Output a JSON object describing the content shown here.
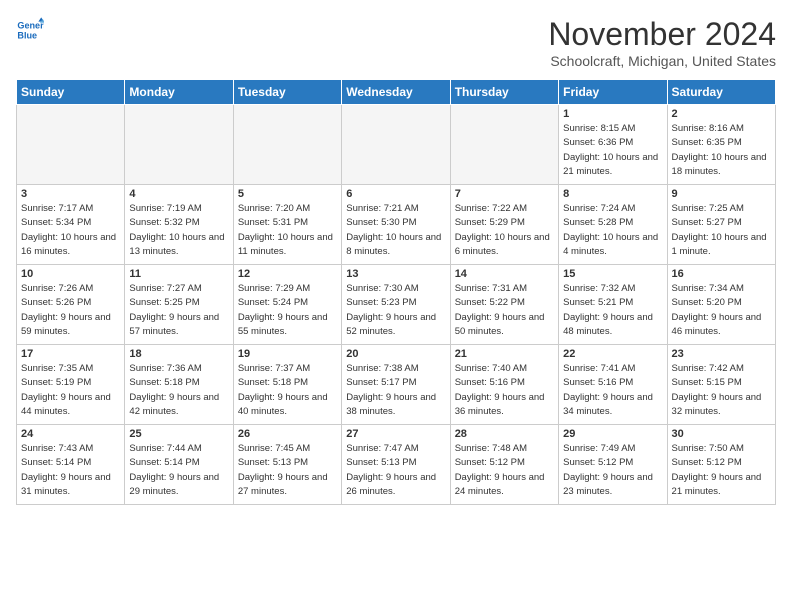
{
  "header": {
    "logo_line1": "General",
    "logo_line2": "Blue",
    "month": "November 2024",
    "location": "Schoolcraft, Michigan, United States"
  },
  "days_of_week": [
    "Sunday",
    "Monday",
    "Tuesday",
    "Wednesday",
    "Thursday",
    "Friday",
    "Saturday"
  ],
  "weeks": [
    [
      {
        "day": "",
        "empty": true
      },
      {
        "day": "",
        "empty": true
      },
      {
        "day": "",
        "empty": true
      },
      {
        "day": "",
        "empty": true
      },
      {
        "day": "",
        "empty": true
      },
      {
        "day": "1",
        "sunrise": "8:15 AM",
        "sunset": "6:36 PM",
        "daylight": "10 hours and 21 minutes."
      },
      {
        "day": "2",
        "sunrise": "8:16 AM",
        "sunset": "6:35 PM",
        "daylight": "10 hours and 18 minutes."
      }
    ],
    [
      {
        "day": "3",
        "sunrise": "7:17 AM",
        "sunset": "5:34 PM",
        "daylight": "10 hours and 16 minutes."
      },
      {
        "day": "4",
        "sunrise": "7:19 AM",
        "sunset": "5:32 PM",
        "daylight": "10 hours and 13 minutes."
      },
      {
        "day": "5",
        "sunrise": "7:20 AM",
        "sunset": "5:31 PM",
        "daylight": "10 hours and 11 minutes."
      },
      {
        "day": "6",
        "sunrise": "7:21 AM",
        "sunset": "5:30 PM",
        "daylight": "10 hours and 8 minutes."
      },
      {
        "day": "7",
        "sunrise": "7:22 AM",
        "sunset": "5:29 PM",
        "daylight": "10 hours and 6 minutes."
      },
      {
        "day": "8",
        "sunrise": "7:24 AM",
        "sunset": "5:28 PM",
        "daylight": "10 hours and 4 minutes."
      },
      {
        "day": "9",
        "sunrise": "7:25 AM",
        "sunset": "5:27 PM",
        "daylight": "10 hours and 1 minute."
      }
    ],
    [
      {
        "day": "10",
        "sunrise": "7:26 AM",
        "sunset": "5:26 PM",
        "daylight": "9 hours and 59 minutes."
      },
      {
        "day": "11",
        "sunrise": "7:27 AM",
        "sunset": "5:25 PM",
        "daylight": "9 hours and 57 minutes."
      },
      {
        "day": "12",
        "sunrise": "7:29 AM",
        "sunset": "5:24 PM",
        "daylight": "9 hours and 55 minutes."
      },
      {
        "day": "13",
        "sunrise": "7:30 AM",
        "sunset": "5:23 PM",
        "daylight": "9 hours and 52 minutes."
      },
      {
        "day": "14",
        "sunrise": "7:31 AM",
        "sunset": "5:22 PM",
        "daylight": "9 hours and 50 minutes."
      },
      {
        "day": "15",
        "sunrise": "7:32 AM",
        "sunset": "5:21 PM",
        "daylight": "9 hours and 48 minutes."
      },
      {
        "day": "16",
        "sunrise": "7:34 AM",
        "sunset": "5:20 PM",
        "daylight": "9 hours and 46 minutes."
      }
    ],
    [
      {
        "day": "17",
        "sunrise": "7:35 AM",
        "sunset": "5:19 PM",
        "daylight": "9 hours and 44 minutes."
      },
      {
        "day": "18",
        "sunrise": "7:36 AM",
        "sunset": "5:18 PM",
        "daylight": "9 hours and 42 minutes."
      },
      {
        "day": "19",
        "sunrise": "7:37 AM",
        "sunset": "5:18 PM",
        "daylight": "9 hours and 40 minutes."
      },
      {
        "day": "20",
        "sunrise": "7:38 AM",
        "sunset": "5:17 PM",
        "daylight": "9 hours and 38 minutes."
      },
      {
        "day": "21",
        "sunrise": "7:40 AM",
        "sunset": "5:16 PM",
        "daylight": "9 hours and 36 minutes."
      },
      {
        "day": "22",
        "sunrise": "7:41 AM",
        "sunset": "5:16 PM",
        "daylight": "9 hours and 34 minutes."
      },
      {
        "day": "23",
        "sunrise": "7:42 AM",
        "sunset": "5:15 PM",
        "daylight": "9 hours and 32 minutes."
      }
    ],
    [
      {
        "day": "24",
        "sunrise": "7:43 AM",
        "sunset": "5:14 PM",
        "daylight": "9 hours and 31 minutes."
      },
      {
        "day": "25",
        "sunrise": "7:44 AM",
        "sunset": "5:14 PM",
        "daylight": "9 hours and 29 minutes."
      },
      {
        "day": "26",
        "sunrise": "7:45 AM",
        "sunset": "5:13 PM",
        "daylight": "9 hours and 27 minutes."
      },
      {
        "day": "27",
        "sunrise": "7:47 AM",
        "sunset": "5:13 PM",
        "daylight": "9 hours and 26 minutes."
      },
      {
        "day": "28",
        "sunrise": "7:48 AM",
        "sunset": "5:12 PM",
        "daylight": "9 hours and 24 minutes."
      },
      {
        "day": "29",
        "sunrise": "7:49 AM",
        "sunset": "5:12 PM",
        "daylight": "9 hours and 23 minutes."
      },
      {
        "day": "30",
        "sunrise": "7:50 AM",
        "sunset": "5:12 PM",
        "daylight": "9 hours and 21 minutes."
      }
    ]
  ]
}
